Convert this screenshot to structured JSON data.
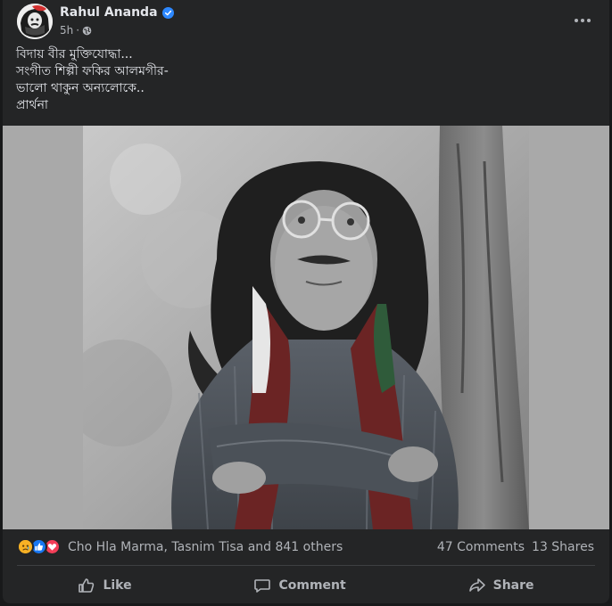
{
  "post": {
    "author": "Rahul Ananda",
    "time": "5h",
    "separator": "·",
    "text": "বিদায় বীর মুক্তিযোদ্ধা...\nসংগীত শিল্পী ফকির আলমগীর-\n ভালো থাকুন অন্যলোকে..\nপ্রার্থনা",
    "photo_alt": "Portrait of a man with long curly hair and round glasses leaning against a tree"
  },
  "reactions": {
    "icons": [
      "sad-reaction",
      "like-reaction",
      "love-reaction"
    ],
    "names": "Cho Hla Marma, Tasnim Tisa and 841 others",
    "comments": "47 Comments",
    "shares": "13 Shares"
  },
  "actions": {
    "like": "Like",
    "comment": "Comment",
    "share": "Share"
  },
  "colors": {
    "background": "#18191a",
    "card": "#242526",
    "text_primary": "#e4e6eb",
    "text_secondary": "#b0b3b8",
    "verified": "#2d88ff",
    "like_blue": "#1877f2",
    "love_red": "#f33e58",
    "sad_yellow": "#f7b125"
  }
}
